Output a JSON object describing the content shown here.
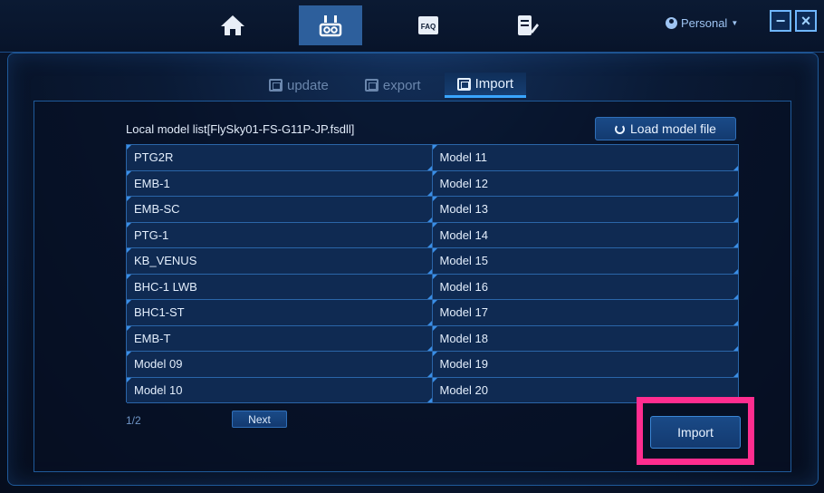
{
  "topbar": {
    "nav": [
      {
        "icon": "home-icon",
        "active": false
      },
      {
        "icon": "remote-controller-icon",
        "active": true
      },
      {
        "icon": "faq-icon",
        "label": "FAQ",
        "active": false
      },
      {
        "icon": "document-edit-icon",
        "active": false
      }
    ],
    "account_label": "Personal",
    "minimize": "−",
    "close": "×"
  },
  "tabs": [
    {
      "label": "update",
      "active": false
    },
    {
      "label": "export",
      "active": false
    },
    {
      "label": "Import",
      "active": true
    }
  ],
  "list": {
    "title": "Local model list[FlySky01-FS-G11P-JP.fsdll]",
    "load_button": "Load  model file",
    "models": [
      "PTG2R",
      "Model 11",
      "EMB-1",
      "Model 12",
      "EMB-SC",
      "Model 13",
      "PTG-1",
      "Model 14",
      "KB_VENUS",
      "Model 15",
      "BHC-1 LWB",
      "Model 16",
      "BHC1-ST",
      "Model 17",
      "EMB-T",
      "Model 18",
      "Model 09",
      "Model 19",
      "Model 10",
      "Model 20"
    ]
  },
  "pager": {
    "page": "1/2",
    "next_label": "Next"
  },
  "actions": {
    "import_label": "Import"
  },
  "colors": {
    "accent": "#39a5ff",
    "highlight": "#ff2d8f",
    "active_nav": "#2d5f9c"
  }
}
